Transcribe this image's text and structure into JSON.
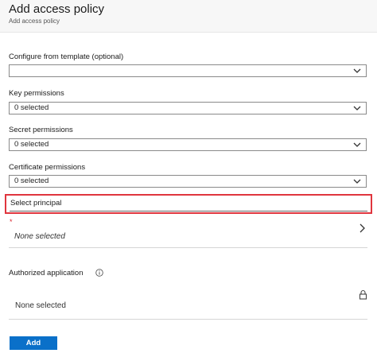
{
  "header": {
    "title": "Add access policy",
    "breadcrumb": "Add access policy"
  },
  "form": {
    "template": {
      "label": "Configure from template (optional)",
      "value": ""
    },
    "key_permissions": {
      "label": "Key permissions",
      "value": "0 selected"
    },
    "secret_permissions": {
      "label": "Secret permissions",
      "value": "0 selected"
    },
    "certificate_permissions": {
      "label": "Certificate permissions",
      "value": "0 selected"
    },
    "principal": {
      "label": "Select principal",
      "required_mark": "*",
      "value": "None selected"
    },
    "authorized_application": {
      "label": "Authorized application",
      "value": "None selected"
    }
  },
  "actions": {
    "add_label": "Add"
  },
  "colors": {
    "accent": "#0a70c9",
    "highlight": "#e0353e",
    "required": "#d9262f"
  },
  "icons": [
    "chevron-down-icon",
    "chevron-right-icon",
    "info-icon",
    "lock-icon"
  ]
}
